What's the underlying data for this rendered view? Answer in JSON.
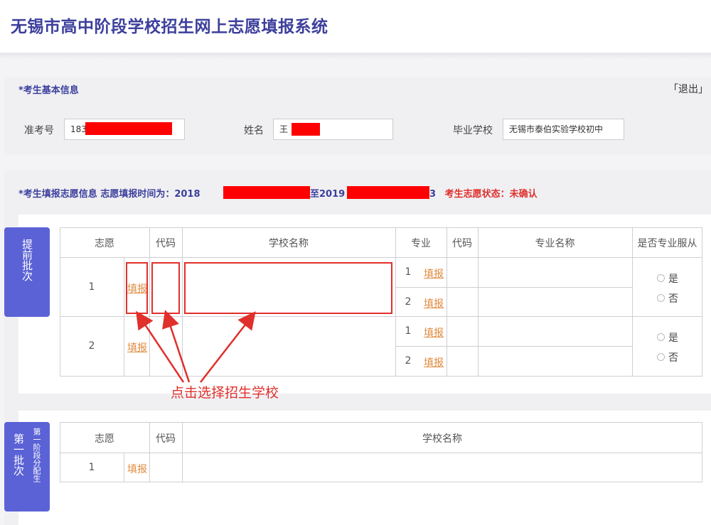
{
  "app": {
    "title": "无锡市高中阶段学校招生网上志愿填报系统"
  },
  "basic_info": {
    "section_title": "*考生基本信息",
    "logout_label": "「退出」",
    "exam_no_label": "准考号",
    "exam_no_value": "183",
    "name_label": "姓名",
    "name_value": "王",
    "school_label": "毕业学校",
    "school_value": "无锡市泰伯实验学校初中"
  },
  "wish_info": {
    "title": "*考生填报志愿信息",
    "period_prefix": "志愿填报时间为：2018",
    "period_mid": "至2019",
    "period_tail": "3",
    "status_label": "考生志愿状态：",
    "status_value": "未确认"
  },
  "early_batch": {
    "tab_label": "提前批次",
    "headers": [
      "志愿",
      "代码",
      "学校名称",
      "专业",
      "代码",
      "专业名称",
      "是否专业服从"
    ],
    "rows": [
      {
        "no": "1",
        "fill_label": "填报",
        "majors": [
          {
            "no": "1",
            "fill_label": "填报"
          },
          {
            "no": "2",
            "fill_label": "填报"
          }
        ],
        "yes_label": "是",
        "no_label": "否"
      },
      {
        "no": "2",
        "fill_label": "填报",
        "majors": [
          {
            "no": "1",
            "fill_label": "填报"
          },
          {
            "no": "2",
            "fill_label": "填报"
          }
        ],
        "yes_label": "是",
        "no_label": "否"
      }
    ]
  },
  "annotation": {
    "text": "点击选择招生学校",
    "color": "#e0302b"
  },
  "first_batch": {
    "tab_label": "第一批次",
    "tab_sub_label": "第一阶段分配生",
    "headers": [
      "志愿",
      "代码",
      "学校名称"
    ],
    "rows": [
      {
        "no": "1",
        "fill_label": "填报"
      }
    ]
  },
  "colors": {
    "brand": "#3c3f9c",
    "tab": "#5b62d6",
    "link": "#e08a3c",
    "alert": "#e0302b"
  }
}
